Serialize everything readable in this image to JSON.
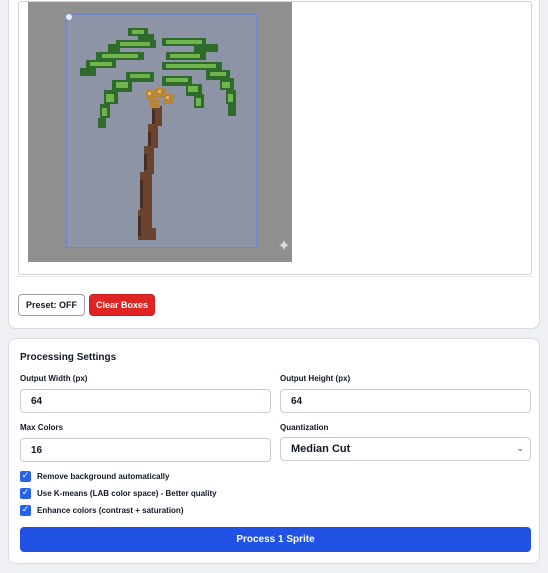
{
  "editor": {
    "sprite_subject": "palm tree pixel sprite",
    "sparkle_icon": "sparkle-icon",
    "preset_label": "Preset: OFF",
    "clear_label": "Clear Boxes"
  },
  "settings": {
    "title": "Processing Settings",
    "output_width_label": "Output Width (px)",
    "output_width_value": "64",
    "output_height_label": "Output Height (px)",
    "output_height_value": "64",
    "max_colors_label": "Max Colors",
    "max_colors_value": "16",
    "quantization_label": "Quantization",
    "quantization_value": "Median Cut",
    "options": [
      {
        "label": "Remove background automatically",
        "checked": true
      },
      {
        "label": "Use K-means (LAB color space) - Better quality",
        "checked": true
      },
      {
        "label": "Enhance colors (contrast + saturation)",
        "checked": true
      }
    ],
    "process_label": "Process 1 Sprite"
  },
  "colors": {
    "accent": "#2152e3",
    "danger": "#e02424",
    "checkbox": "#2563eb",
    "canvas_bg": "#8f8f8f",
    "selection_bg": "#8c94a6",
    "leaf_dark": "#2f6b2a",
    "leaf_light": "#6fb44c",
    "trunk": "#6b4430",
    "coconut": "#b8863b"
  }
}
